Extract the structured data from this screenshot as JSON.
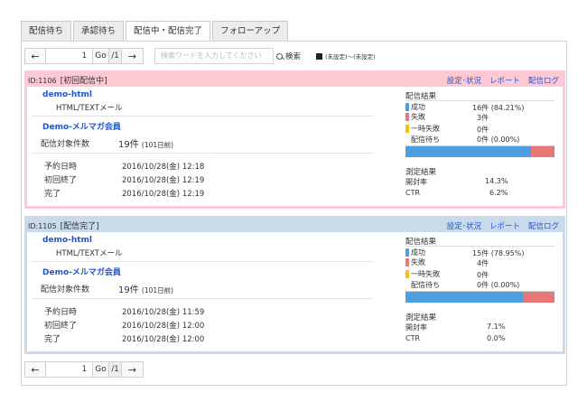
{
  "tabs": [
    "配信待ち",
    "承認待ち",
    "配信中・配信完了",
    "フォローアップ"
  ],
  "pager": {
    "page": "1",
    "go": "Go",
    "total": "/1"
  },
  "search": {
    "placeholder": "検索ワードを入力してください",
    "button": "検索",
    "date_range": "(未設定)〜(未設定)"
  },
  "campaigns": [
    {
      "id": "ID:1106",
      "status": "[初回配信中]",
      "links": {
        "settings": "設定･状況",
        "report": "レポート",
        "log": "配信ログ"
      },
      "name": "demo-html",
      "format": "HTML/TEXTメール",
      "group": "Demo-メルマガ会員",
      "target_label": "配信対象件数",
      "target_value": "19件",
      "target_note": "(101日前)",
      "scheduled_label": "予約日時",
      "scheduled": "2016/10/28(金) 12:18",
      "first_end_label": "初回終了",
      "first_end": "2016/10/28(金) 12:19",
      "complete_label": "完了",
      "complete": "2016/10/28(金) 12:19",
      "results_title": "配信結果",
      "success_label": "成功",
      "success": "16件 (84.21%)",
      "fail_label": "失敗",
      "fail": "3件",
      "temp_fail_label": "一時失敗",
      "temp_fail": "0件",
      "waiting_label": "配信待ち",
      "waiting": "0件 (0.00%)",
      "success_ratio": 0.8421,
      "measure_title": "測定結果",
      "open_label": "開封率",
      "open_rate": "14.3%",
      "ctr_label": "CTR",
      "ctr": "6.2%",
      "colors": {
        "border": "#ffc9d4"
      }
    },
    {
      "id": "ID:1105",
      "status": "[配信完了]",
      "links": {
        "settings": "設定･状況",
        "report": "レポート",
        "log": "配信ログ"
      },
      "name": "demo-html",
      "format": "HTML/TEXTメール",
      "group": "Demo-メルマガ会員",
      "target_label": "配信対象件数",
      "target_value": "19件",
      "target_note": "(101日前)",
      "scheduled_label": "予約日時",
      "scheduled": "2016/10/28(金) 11:59",
      "first_end_label": "初回終了",
      "first_end": "2016/10/28(金) 12:00",
      "complete_label": "完了",
      "complete": "2016/10/28(金) 12:00",
      "results_title": "配信結果",
      "success_label": "成功",
      "success": "15件 (78.95%)",
      "fail_label": "失敗",
      "fail": "4件",
      "temp_fail_label": "一時失敗",
      "temp_fail": "0件",
      "waiting_label": "配信待ち",
      "waiting": "0件 (0.00%)",
      "success_ratio": 0.7895,
      "measure_title": "測定結果",
      "open_label": "開封率",
      "open_rate": "7.1%",
      "ctr_label": "CTR",
      "ctr": "0.0%",
      "colors": {
        "border": "#c9dbeb"
      }
    }
  ],
  "colors": {
    "link": "#2255cc",
    "success": "#4d9fe0",
    "fail": "#e87878",
    "temp_fail": "#f4c20d"
  }
}
